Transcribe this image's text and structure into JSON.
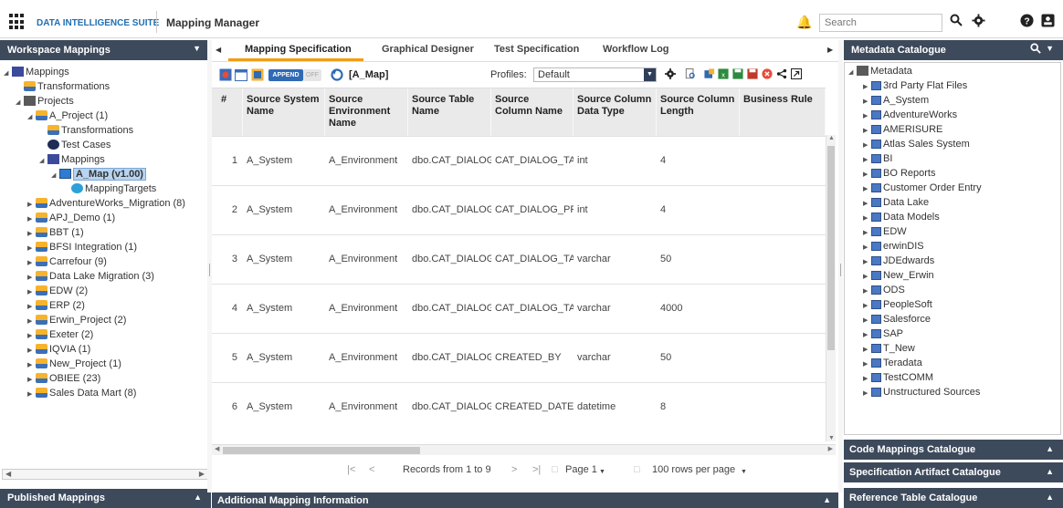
{
  "header": {
    "suite_name": "DATA INTELLIGENCE SUITE",
    "module_name": "Mapping Manager",
    "search_placeholder": "Search"
  },
  "left_panel": {
    "title": "Workspace Mappings",
    "tree": [
      {
        "label": "Mappings",
        "level": 0,
        "expand": "open",
        "icon": "mapping-root-icon"
      },
      {
        "label": "Transformations",
        "level": 1,
        "expand": "none",
        "icon": "transformations-icon"
      },
      {
        "label": "Projects",
        "level": 1,
        "expand": "open",
        "icon": "projects-icon"
      },
      {
        "label": "A_Project (1)",
        "level": 2,
        "expand": "open",
        "icon": "project-folder-icon"
      },
      {
        "label": "Transformations",
        "level": 3,
        "expand": "none",
        "icon": "transformations-icon"
      },
      {
        "label": "Test Cases",
        "level": 3,
        "expand": "none",
        "icon": "test-cases-icon"
      },
      {
        "label": "Mappings",
        "level": 3,
        "expand": "open",
        "icon": "mappings-folder-icon"
      },
      {
        "label": "A_Map (v1.00)",
        "level": 4,
        "expand": "open",
        "icon": "map-table-icon",
        "selected": true
      },
      {
        "label": "MappingTargets",
        "level": 5,
        "expand": "none",
        "icon": "mapping-targets-icon"
      },
      {
        "label": "AdventureWorks_Migration (8)",
        "level": 2,
        "expand": "closed",
        "icon": "project-folder-icon"
      },
      {
        "label": "APJ_Demo (1)",
        "level": 2,
        "expand": "closed",
        "icon": "project-folder-icon"
      },
      {
        "label": "BBT (1)",
        "level": 2,
        "expand": "closed",
        "icon": "project-folder-icon"
      },
      {
        "label": "BFSI Integration (1)",
        "level": 2,
        "expand": "closed",
        "icon": "project-folder-icon"
      },
      {
        "label": "Carrefour (9)",
        "level": 2,
        "expand": "closed",
        "icon": "project-folder-icon"
      },
      {
        "label": "Data Lake Migration (3)",
        "level": 2,
        "expand": "closed",
        "icon": "project-folder-icon"
      },
      {
        "label": "EDW (2)",
        "level": 2,
        "expand": "closed",
        "icon": "project-folder-icon"
      },
      {
        "label": "ERP (2)",
        "level": 2,
        "expand": "closed",
        "icon": "project-folder-icon"
      },
      {
        "label": "Erwin_Project (2)",
        "level": 2,
        "expand": "closed",
        "icon": "project-folder-icon"
      },
      {
        "label": "Exeter (2)",
        "level": 2,
        "expand": "closed",
        "icon": "project-folder-icon"
      },
      {
        "label": "IQVIA (1)",
        "level": 2,
        "expand": "closed",
        "icon": "project-folder-icon"
      },
      {
        "label": "New_Project (1)",
        "level": 2,
        "expand": "closed",
        "icon": "project-folder-icon"
      },
      {
        "label": "OBIEE (23)",
        "level": 2,
        "expand": "closed",
        "icon": "project-folder-icon"
      },
      {
        "label": "Sales Data Mart (8)",
        "level": 2,
        "expand": "closed",
        "icon": "project-folder-icon"
      }
    ],
    "bottom_title": "Published Mappings"
  },
  "center": {
    "tabs": [
      {
        "label": "Mapping Specification",
        "active": true
      },
      {
        "label": "Graphical Designer",
        "active": false
      },
      {
        "label": "Test Specification",
        "active": false
      },
      {
        "label": "Workflow Log",
        "active": false
      }
    ],
    "toolbar": {
      "append_label": "APPEND",
      "off_label": "OFF",
      "map_name": "[A_Map]",
      "profiles_label": "Profiles:",
      "profiles_value": "Default"
    },
    "grid": {
      "columns": [
        "#",
        "Source System Name",
        "Source Environment Name",
        "Source Table Name",
        "Source Column Name",
        "Source Column Data Type",
        "Source Column Length",
        "Business Rule"
      ],
      "rows": [
        [
          "1",
          "A_System",
          "A_Environment",
          "dbo.CAT_DIALOG",
          "CAT_DIALOG_TAB",
          "int",
          "4",
          ""
        ],
        [
          "2",
          "A_System",
          "A_Environment",
          "dbo.CAT_DIALOG",
          "CAT_DIALOG_PRC",
          "int",
          "4",
          ""
        ],
        [
          "3",
          "A_System",
          "A_Environment",
          "dbo.CAT_DIALOG",
          "CAT_DIALOG_TAB",
          "varchar",
          "50",
          ""
        ],
        [
          "4",
          "A_System",
          "A_Environment",
          "dbo.CAT_DIALOG",
          "CAT_DIALOG_TAB",
          "varchar",
          "4000",
          ""
        ],
        [
          "5",
          "A_System",
          "A_Environment",
          "dbo.CAT_DIALOG",
          "CREATED_BY",
          "varchar",
          "50",
          ""
        ],
        [
          "6",
          "A_System",
          "A_Environment",
          "dbo.CAT_DIALOG",
          "CREATED_DATE_TI",
          "datetime",
          "8",
          ""
        ]
      ]
    },
    "pager": {
      "first": "|<",
      "prev": "<",
      "records": "Records from 1 to 9",
      "next": ">",
      "last": ">|",
      "page": "Page 1",
      "rows_per_page": "100 rows per page"
    },
    "bottom_title": "Additional Mapping Information"
  },
  "right_panel": {
    "title": "Metadata Catalogue",
    "root": "Metadata",
    "items": [
      "3rd Party Flat Files",
      "A_System",
      "AdventureWorks",
      "AMERISURE",
      "Atlas Sales System",
      "BI",
      "BO Reports",
      "Customer Order Entry",
      "Data Lake",
      "Data Models",
      "EDW",
      "erwinDIS",
      "JDEdwards",
      "New_Erwin",
      "ODS",
      "PeopleSoft",
      "Salesforce",
      "SAP",
      "T_New",
      "Teradata",
      "TestCOMM",
      "Unstructured Sources"
    ],
    "accordions": [
      "Code Mappings Catalogue",
      "Specification Artifact Catalogue",
      "Reference Table Catalogue"
    ]
  },
  "colors": {
    "panel_header": "#3d4a5c",
    "tab_accent": "#f39c12",
    "brand": "#1f6fb2",
    "selection": "#b8d4f0"
  }
}
